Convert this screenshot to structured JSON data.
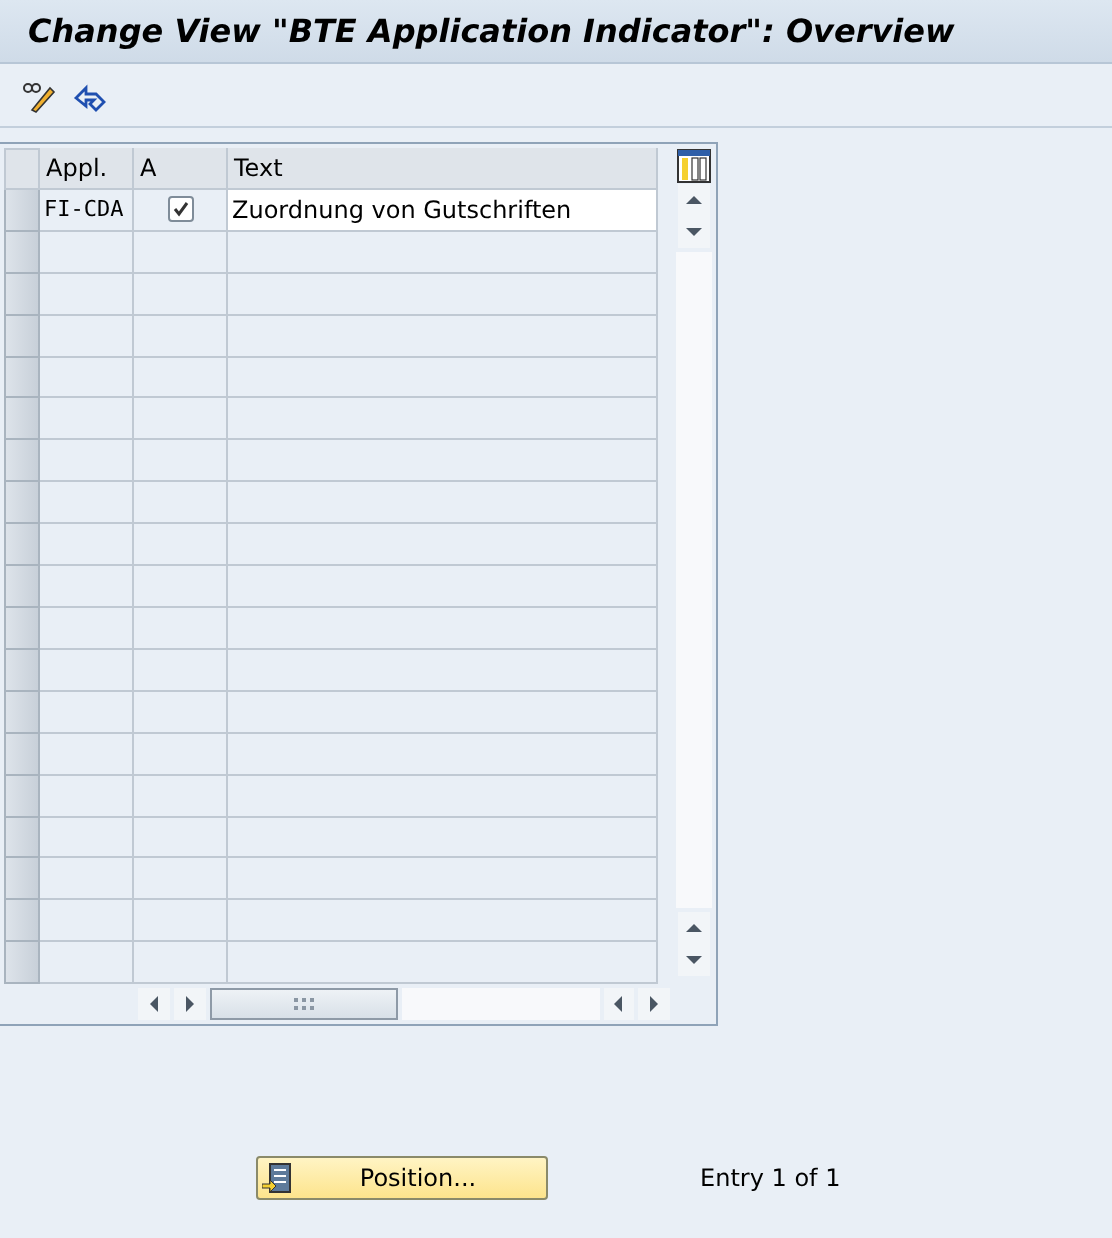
{
  "window": {
    "title": "Change View \"BTE Application Indicator\": Overview"
  },
  "table": {
    "columns": [
      "Appl.",
      "A",
      "Text"
    ],
    "rows": [
      {
        "appl": "FI-CDA",
        "checked": true,
        "text": "Zuordnung von Gutschriften"
      }
    ]
  },
  "footer": {
    "button": "Position...",
    "entry": "Entry 1 of 1"
  }
}
